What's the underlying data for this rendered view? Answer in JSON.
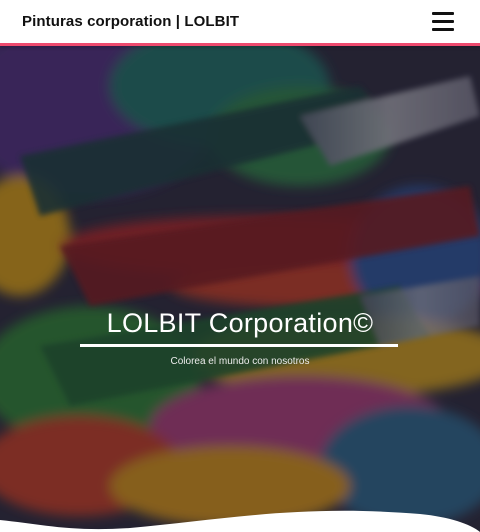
{
  "header": {
    "brand": "Pinturas corporation | LOLBIT",
    "menu_icon": "hamburger-menu-icon",
    "accent_color": "#ee4a6e"
  },
  "hero": {
    "title": "LOLBIT Corporation©",
    "subtitle": "Colorea el mundo con nosotros",
    "background_image": "paint-brushes-photo",
    "overlay_color": "#000000"
  }
}
